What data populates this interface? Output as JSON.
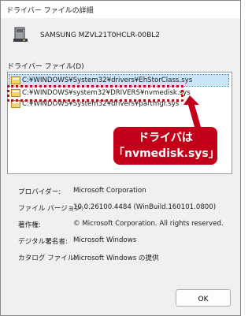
{
  "window": {
    "title": "ドライバー ファイルの詳細"
  },
  "device": {
    "icon": "drive-icon",
    "name": "SAMSUNG MZVL21T0HCLR-00BL2"
  },
  "files": {
    "label": "ドライバー ファイル(D)",
    "items": [
      {
        "path": "C:¥WINDOWS¥System32¥drivers¥EhStorClass.sys",
        "selected": true
      },
      {
        "path": "C:¥WINDOWS¥system32¥DRIVERS¥nvmedisk.sys",
        "selected": false
      },
      {
        "path": "C:¥WINDOWS¥System32¥drivers¥partmgr.sys",
        "selected": false
      }
    ]
  },
  "callout": {
    "line1": "ドライバは",
    "line2": "「nvmedisk.sys」",
    "color": "#c3001a"
  },
  "properties": [
    {
      "label": "プロバイダー:",
      "value": "Microsoft Corporation"
    },
    {
      "label": "ファイル バージョン:",
      "value": "10.0.26100.4484 (WinBuild.160101.0800)"
    },
    {
      "label": "著作権:",
      "value": "© Microsoft Corporation. All rights reserved."
    },
    {
      "label": "デジタル署名者:",
      "value": "Microsoft Windows"
    },
    {
      "label": "カタログ ファイル:",
      "value": "Microsoft Windows の提供"
    }
  ],
  "buttons": {
    "ok": "OK"
  }
}
